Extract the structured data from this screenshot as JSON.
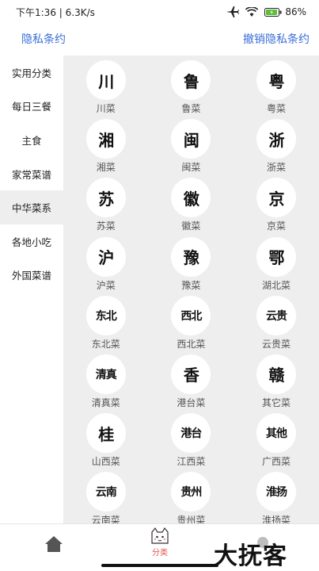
{
  "status_bar": {
    "time": "下午1:36 | 6.3K/s",
    "battery": "86%"
  },
  "top_bar": {
    "left_link": "隐私条约",
    "right_link": "撤销隐私条约"
  },
  "sidebar": {
    "active_index": 4,
    "items": [
      {
        "label": "实用分类"
      },
      {
        "label": "每日三餐"
      },
      {
        "label": "主食"
      },
      {
        "label": "家常菜谱"
      },
      {
        "label": "中华菜系"
      },
      {
        "label": "各地小吃"
      },
      {
        "label": "外国菜谱"
      }
    ]
  },
  "grid": {
    "items": [
      {
        "glyph": "川",
        "label": "川菜"
      },
      {
        "glyph": "鲁",
        "label": "鲁菜"
      },
      {
        "glyph": "粤",
        "label": "粤菜"
      },
      {
        "glyph": "湘",
        "label": "湘菜"
      },
      {
        "glyph": "闽",
        "label": "闽菜"
      },
      {
        "glyph": "浙",
        "label": "浙菜"
      },
      {
        "glyph": "苏",
        "label": "苏菜"
      },
      {
        "glyph": "徽",
        "label": "徽菜"
      },
      {
        "glyph": "京",
        "label": "京菜"
      },
      {
        "glyph": "沪",
        "label": "沪菜"
      },
      {
        "glyph": "豫",
        "label": "豫菜"
      },
      {
        "glyph": "鄂",
        "label": "湖北菜"
      },
      {
        "glyph": "东北",
        "label": "东北菜"
      },
      {
        "glyph": "西北",
        "label": "西北菜"
      },
      {
        "glyph": "云贵",
        "label": "云贵菜"
      },
      {
        "glyph": "清真",
        "label": "清真菜"
      },
      {
        "glyph": "香",
        "label": "港台菜"
      },
      {
        "glyph": "赣",
        "label": "其它菜"
      },
      {
        "glyph": "桂",
        "label": "山西菜"
      },
      {
        "glyph": "港台",
        "label": "江西菜"
      },
      {
        "glyph": "其他",
        "label": "广西菜"
      },
      {
        "glyph": "云南",
        "label": "云南菜"
      },
      {
        "glyph": "贵州",
        "label": "贵州菜"
      },
      {
        "glyph": "淮扬",
        "label": "淮扬菜"
      }
    ]
  },
  "bottom_nav": {
    "category_label": "分类"
  },
  "watermark": "大抚客",
  "colors": {
    "link": "#3a6fd8",
    "active_tab": "#e0564a",
    "panel_bg": "#eeeeee"
  }
}
